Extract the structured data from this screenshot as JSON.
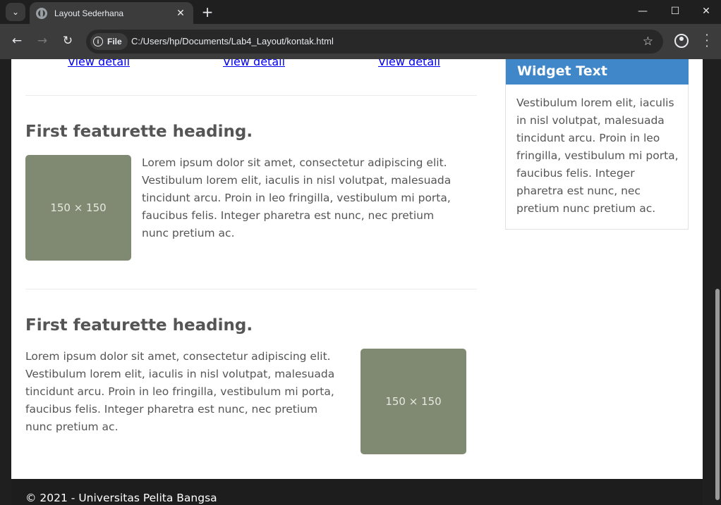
{
  "browser": {
    "tab_title": "Layout Sederhana",
    "chip_label": "File",
    "url": "C:/Users/hp/Documents/Lab4_Layout/kontak.html"
  },
  "page": {
    "links": [
      "View detail",
      "View detail",
      "View detail"
    ],
    "featurettes": [
      {
        "heading": "First featurette heading.",
        "text": "Lorem ipsum dolor sit amet, consectetur adipiscing elit. Vestibulum lorem elit, iaculis in nisl volutpat, malesuada tincidunt arcu. Proin in leo fringilla, vestibulum mi porta, faucibus felis. Integer pharetra est nunc, nec pretium nunc pretium ac.",
        "image_label": "150 × 150"
      },
      {
        "heading": "First featurette heading.",
        "text": "Lorem ipsum dolor sit amet, consectetur adipiscing elit. Vestibulum lorem elit, iaculis in nisl volutpat, malesuada tincidunt arcu. Proin in leo fringilla, vestibulum mi porta, faucibus felis. Integer pharetra est nunc, nec pretium nunc pretium ac.",
        "image_label": "150 × 150"
      }
    ],
    "widget": {
      "title": "Widget Text",
      "body": "Vestibulum lorem elit, iaculis in nisl volutpat, malesuada tincidunt arcu. Proin in leo fringilla, vestibulum mi porta, faucibus felis. Integer pharetra est nunc, nec pretium nunc pretium ac."
    },
    "footer": "© 2021 - Universitas Pelita Bangsa"
  },
  "colors": {
    "accent": "#3f87c9",
    "placeholder": "#808a72",
    "footer_bg": "#1d1d1d"
  }
}
